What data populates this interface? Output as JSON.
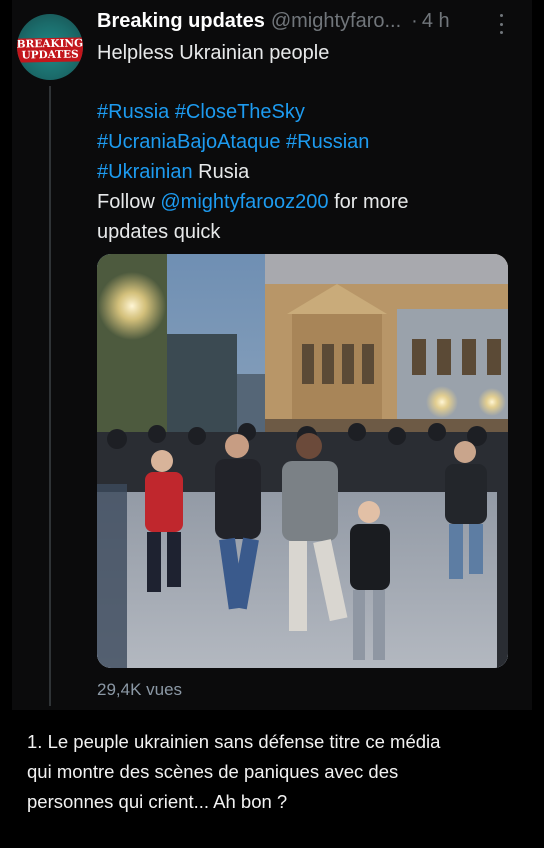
{
  "tweet": {
    "avatar_text": "BREAKING\nUPDATES",
    "author_name": "Breaking updates",
    "author_handle": "@mightyfaro...",
    "separator": "·",
    "time": "4 h",
    "lines": [
      "Helpless Ukrainian people",
      "",
      "#Russia #CloseTheSky",
      "#UcraniaBajoAtaque #Russian",
      "#Ukrainian",
      "Rusia",
      "Follow",
      "@mightyfarooz200",
      "for more",
      "updates quick"
    ],
    "views": "29,4K vues"
  },
  "caption": {
    "lines": [
      "1. Le peuple ukrainien sans défense titre ce média",
      "qui montre des scènes de paniques avec des",
      "personnes qui crient... Ah bon ?"
    ]
  },
  "colors": {
    "link": "#1d9bf0",
    "text": "#e7e9ea",
    "muted": "#71767b",
    "avatar_banner": "#c3161c",
    "avatar_ring": "#1f8a88"
  }
}
